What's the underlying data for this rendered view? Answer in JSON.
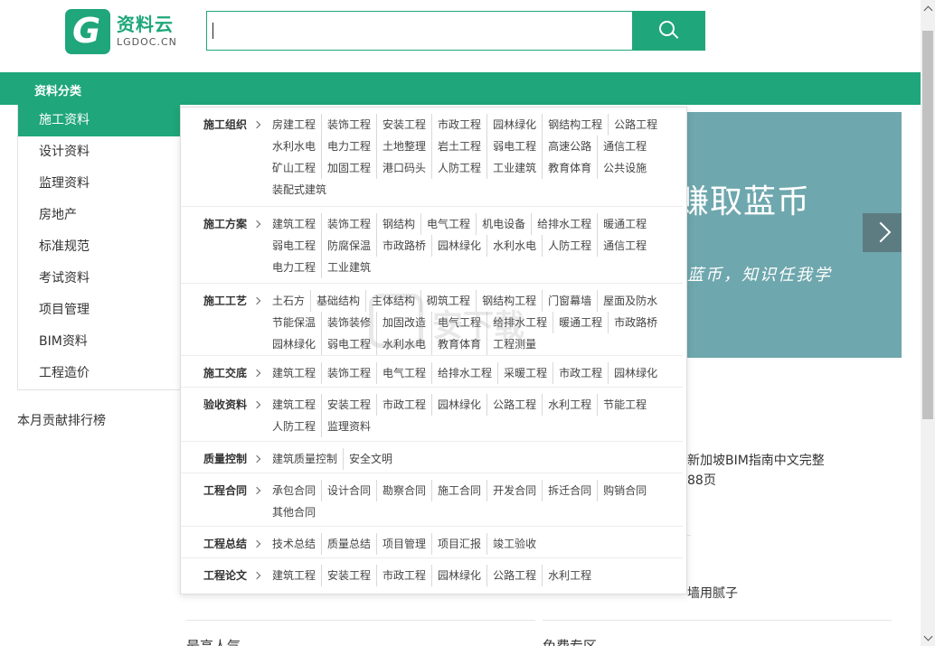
{
  "brand": {
    "name_cn": "资料云",
    "name_en": "LGDOC.CN",
    "color": "#1fa67a"
  },
  "search": {
    "placeholder": "",
    "value": ""
  },
  "nav": {
    "title": "资料分类"
  },
  "categories": [
    "施工资料",
    "设计资料",
    "监理资料",
    "房地产",
    "标准规范",
    "考试资料",
    "项目管理",
    "BIM资料",
    "工程造价"
  ],
  "rank_title": "本月贡献排行榜",
  "banner": {
    "headline": "赚取蓝币",
    "tagline": "有蓝币，知识任我学"
  },
  "menu": [
    {
      "title": "施工组织",
      "items": [
        "房建工程",
        "装饰工程",
        "安装工程",
        "市政工程",
        "园林绿化",
        "钢结构工程",
        "公路工程",
        "水利水电",
        "电力工程",
        "土地整理",
        "岩土工程",
        "弱电工程",
        "高速公路",
        "通信工程",
        "矿山工程",
        "加固工程",
        "港口码头",
        "人防工程",
        "工业建筑",
        "教育体育",
        "公共设施",
        "装配式建筑"
      ]
    },
    {
      "title": "施工方案",
      "items": [
        "建筑工程",
        "装饰工程",
        "钢结构",
        "电气工程",
        "机电设备",
        "给排水工程",
        "暖通工程",
        "弱电工程",
        "防腐保温",
        "市政路桥",
        "园林绿化",
        "水利水电",
        "人防工程",
        "通信工程",
        "电力工程",
        "工业建筑"
      ]
    },
    {
      "title": "施工工艺",
      "items": [
        "土石方",
        "基础结构",
        "主体结构",
        "砌筑工程",
        "钢结构工程",
        "门窗幕墙",
        "屋面及防水",
        "节能保温",
        "装饰装修",
        "加固改造",
        "电气工程",
        "给排水工程",
        "暖通工程",
        "市政路桥",
        "园林绿化",
        "弱电工程",
        "水利水电",
        "教育体育",
        "工程测量"
      ]
    },
    {
      "title": "施工交底",
      "items": [
        "建筑工程",
        "装饰工程",
        "电气工程",
        "给排水工程",
        "采暖工程",
        "市政工程",
        "园林绿化"
      ]
    },
    {
      "title": "验收资料",
      "items": [
        "建筑工程",
        "安装工程",
        "市政工程",
        "园林绿化",
        "公路工程",
        "水利工程",
        "节能工程",
        "人防工程",
        "监理资料"
      ]
    },
    {
      "title": "质量控制",
      "items": [
        "建筑质量控制",
        "安全文明"
      ]
    },
    {
      "title": "工程合同",
      "items": [
        "承包合同",
        "设计合同",
        "勘察合同",
        "施工合同",
        "开发合同",
        "拆迁合同",
        "购销合同",
        "其他合同"
      ]
    },
    {
      "title": "工程总结",
      "items": [
        "技术总结",
        "质量总结",
        "项目管理",
        "项目汇报",
        "竣工验收"
      ]
    },
    {
      "title": "工程论文",
      "items": [
        "建筑工程",
        "安装工程",
        "市政工程",
        "园林绿化",
        "公路工程",
        "水利工程"
      ]
    }
  ],
  "background_text": {
    "line1": "新加坡BIM指南中文完整",
    "line2": "88页",
    "line3": "墙用腻子",
    "bottom_left": "最高人气",
    "bottom_right": "免费专区"
  },
  "watermark": "安下载"
}
